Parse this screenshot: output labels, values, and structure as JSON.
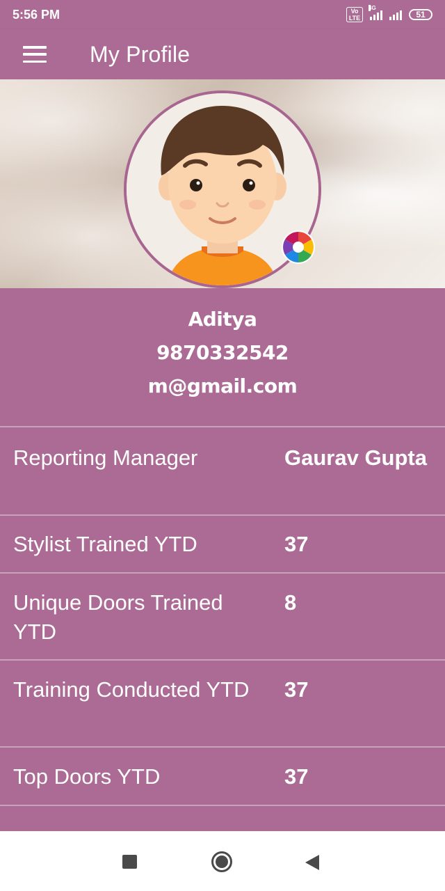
{
  "status_bar": {
    "time": "5:56 PM",
    "volte": "Vo LTE",
    "network_label": "4G",
    "battery": "51"
  },
  "app_bar": {
    "title": "My Profile",
    "menu_icon": "hamburger-menu-icon"
  },
  "profile": {
    "name": "Aditya",
    "phone": "9870332542",
    "email": "m@gmail.com",
    "avatar_icon": "avatar-boy-icon",
    "camera_icon": "camera-icon"
  },
  "details": [
    {
      "label": "Reporting Manager",
      "value": "Gaurav Gupta"
    },
    {
      "label": "Stylist Trained YTD",
      "value": "37"
    },
    {
      "label": "Unique Doors Trained YTD",
      "value": "8"
    },
    {
      "label": "Training Conducted YTD",
      "value": "37"
    },
    {
      "label": "Top Doors YTD",
      "value": "37"
    }
  ],
  "colors": {
    "primary": "#ac6b94",
    "divider": "#c9a3ba",
    "avatar_ring": "#a76590"
  },
  "nav_bar": {
    "icons": [
      "recents-square-icon",
      "home-circle-icon",
      "back-triangle-icon"
    ]
  }
}
